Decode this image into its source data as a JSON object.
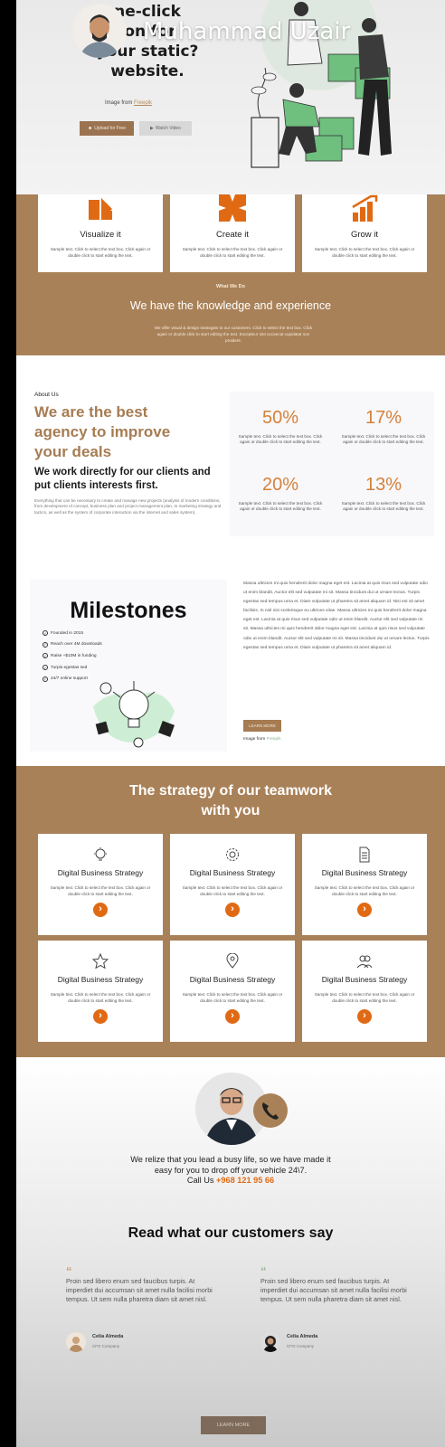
{
  "hero": {
    "title_lines": [
      "ne-click",
      "ion for",
      "your static?",
      "website."
    ],
    "credit_prefix": "Image from ",
    "credit_link": "Freepik",
    "upload_label": "Upload for Free",
    "video_label": "Watch Video"
  },
  "overlay": {
    "name": "Muhammad Uzair"
  },
  "services": {
    "cards": [
      {
        "title": "Visualize it",
        "text": "Sample text. Click to select the text box. Click again or double click to start editing the text."
      },
      {
        "title": "Create it",
        "text": "Sample text. Click to select the text box. Click again or double click to start editing the text."
      },
      {
        "title": "Grow it",
        "text": "Sample text. Click to select the text box. Click again or double click to start editing the text."
      }
    ],
    "label": "What We Do",
    "title": "We have the knowledge and experience",
    "text": "We offer visual & design strategies to our customers. Click to select the text box. Click again or double click to start editing the text. Excepteur sint occaecat cupidatat non proident."
  },
  "about": {
    "label": "About Us",
    "headline_lines": [
      "We are the best",
      "agency to improve",
      "your deals"
    ],
    "subheadline": "We work directly for our clients and put clients interests first.",
    "text": "Everything that can be necessary to create and manage new projects (analysis of modern conditions, from development of concept, business plan and project management plan, to marketing strategy and tactics, as well as the system of corporate interaction via the internet and sales system).",
    "stats": [
      {
        "value": "50%",
        "text": "Sample text. Click to select the text box. Click again or double click to start editing the text."
      },
      {
        "value": "17%",
        "text": "Sample text. Click to select the text box. Click again or double click to start editing the text."
      },
      {
        "value": "20%",
        "text": "Sample text. Click to select the text box. Click again or double click to start editing the text."
      },
      {
        "value": "13%",
        "text": "Sample text. Click to select the text box. Click again or double click to start editing the text."
      }
    ]
  },
  "milestones": {
    "title": "Milestones",
    "items": [
      "Founded in 2015",
      "Reach over 4M downloads",
      "Raise +$10M in funding",
      "Turpis egestas sed",
      "24/7 online support"
    ],
    "text": "Massa ultricies mi quis hendrerit dolor magna eget est. Lacinia at quis risus sed vulputate odio ut enim blandit. Auctor elit sed vulputate mi sit. Massa tincidunt dui ut ornare lectus. Turpis egestas sed tempus urna et. Diam vulputate ut pharetra sit amet aliquam id. Nisi est sit amet facilisis. In nisl nisi scelerisque eu ultrices vitae. Massa ultricies mi quis hendrerit dolor magna eget est. Lacinia at quis risus sed vulputate odio ut enim blandit. Auctor elit sed vulputate mi sit. Massa ultricies mi quis hendrerit dolor magna eget est. Lacinia at quis risus sed vulputate odio ut enim blandit. Auctor elit sed vulputate mi sit. Massa tincidunt dui ut ornare lectus. Turpis egestas sed tempus urna et. Diam vulputate ut pharetra sit amet aliquam id.",
    "button_label": "LEARN MORE",
    "credit_prefix": "Image from ",
    "credit_link": "Freepik"
  },
  "strategy": {
    "title_lines": [
      "The strategy of our teamwork",
      "with you"
    ],
    "cards": [
      {
        "icon": "bulb-icon",
        "title": "Digital Business Strategy",
        "text": "Sample text. Click to select the text box. Click again or double click to start editing the text."
      },
      {
        "icon": "gear-icon",
        "title": "Digital Business Strategy",
        "text": "Sample text. Click to select the text box. Click again or double click to start editing the text."
      },
      {
        "icon": "document-icon",
        "title": "Digital Business Strategy",
        "text": "Sample text. Click to select the text box. Click again or double click to start editing the text."
      },
      {
        "icon": "star-icon",
        "title": "Digital Business Strategy",
        "text": "Sample text. Click to select the text box. Click again or double click to start editing the text."
      },
      {
        "icon": "map-pin-icon",
        "title": "Digital Business Strategy",
        "text": "Sample text. Click to select the text box. Click again or double click to start editing the text."
      },
      {
        "icon": "users-icon",
        "title": "Digital Business Strategy",
        "text": "Sample text. Click to select the text box. Click again or double click to start editing the text."
      }
    ]
  },
  "contact": {
    "text_line1": "We relize that you lead a busy life, so we have made it",
    "text_line2": "easy for you to drop off your vehicle 24\\7.",
    "call_prefix": "Call Us ",
    "phone": "+968 121 95 66"
  },
  "reviews": {
    "title": "Read what our customers say",
    "items": [
      {
        "text": "Proin sed libero enum sed faucibus turpis. At imperdiet dui accumsan sit amet nulla facilisi morbi tempus. Ut sem nulla pharetra diam sit amet nisl.",
        "name": "Celia Almeda",
        "role": "CFO Company"
      },
      {
        "text": "Proin sed libero enum sed faucibus turpis. At imperdiet dui accumsan sit amet nulla facilisi morbi tempus. Ut sem nulla pharetra diam sit amet nisl.",
        "name": "Celia Almeda",
        "role": "CFO Company"
      }
    ],
    "button_label": "LEARN MORE"
  },
  "colors": {
    "brand": "#a98158",
    "accent": "#e06a14",
    "stat": "#d4823a"
  }
}
